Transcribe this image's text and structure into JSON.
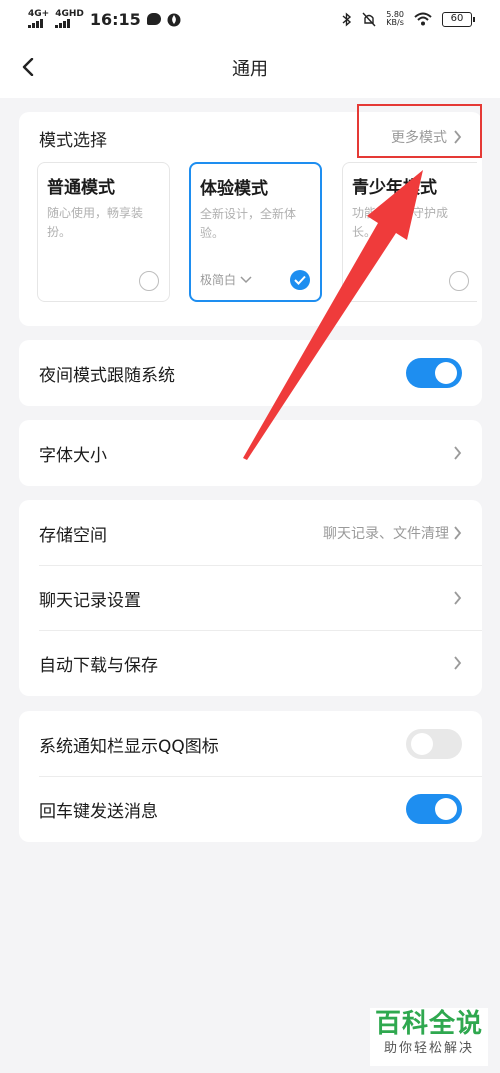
{
  "status_bar": {
    "sig1": "4G+",
    "sig2": "4GHD",
    "time": "16:15",
    "net_speed_value": "5.80",
    "net_speed_unit": "KB/s",
    "battery": "60"
  },
  "nav": {
    "title": "通用"
  },
  "mode_section": {
    "title": "模式选择",
    "more_label": "更多模式",
    "modes": [
      {
        "name": "普通模式",
        "desc": "随心使用，畅享装扮。"
      },
      {
        "name": "体验模式",
        "desc": "全新设计，全新体验。",
        "theme": "极简白"
      },
      {
        "name": "青少年模式",
        "desc": "功能管控，守护成长。"
      }
    ]
  },
  "night_mode": {
    "label": "夜间模式跟随系统",
    "state": "on"
  },
  "font_size": {
    "label": "字体大小"
  },
  "storage_group": {
    "storage": {
      "label": "存储空间",
      "value": "聊天记录、文件清理"
    },
    "chat_settings": {
      "label": "聊天记录设置"
    },
    "auto_download": {
      "label": "自动下载与保存"
    }
  },
  "notify_group": {
    "qq_icon": {
      "label": "系统通知栏显示QQ图标",
      "state": "off"
    },
    "enter_send": {
      "label": "回车键发送消息",
      "state": "on"
    }
  },
  "watermark": {
    "title": "百科全说",
    "subtitle": "助你轻松解决"
  },
  "colors": {
    "accent": "#1e8ef0",
    "annotation": "#e53935",
    "watermark": "#2fa84f"
  },
  "icons": [
    "back-arrow-icon",
    "chevron-right-icon",
    "chevron-down-icon",
    "checkmark-icon",
    "wifi-icon",
    "bluetooth-icon",
    "mute-icon",
    "battery-icon"
  ]
}
